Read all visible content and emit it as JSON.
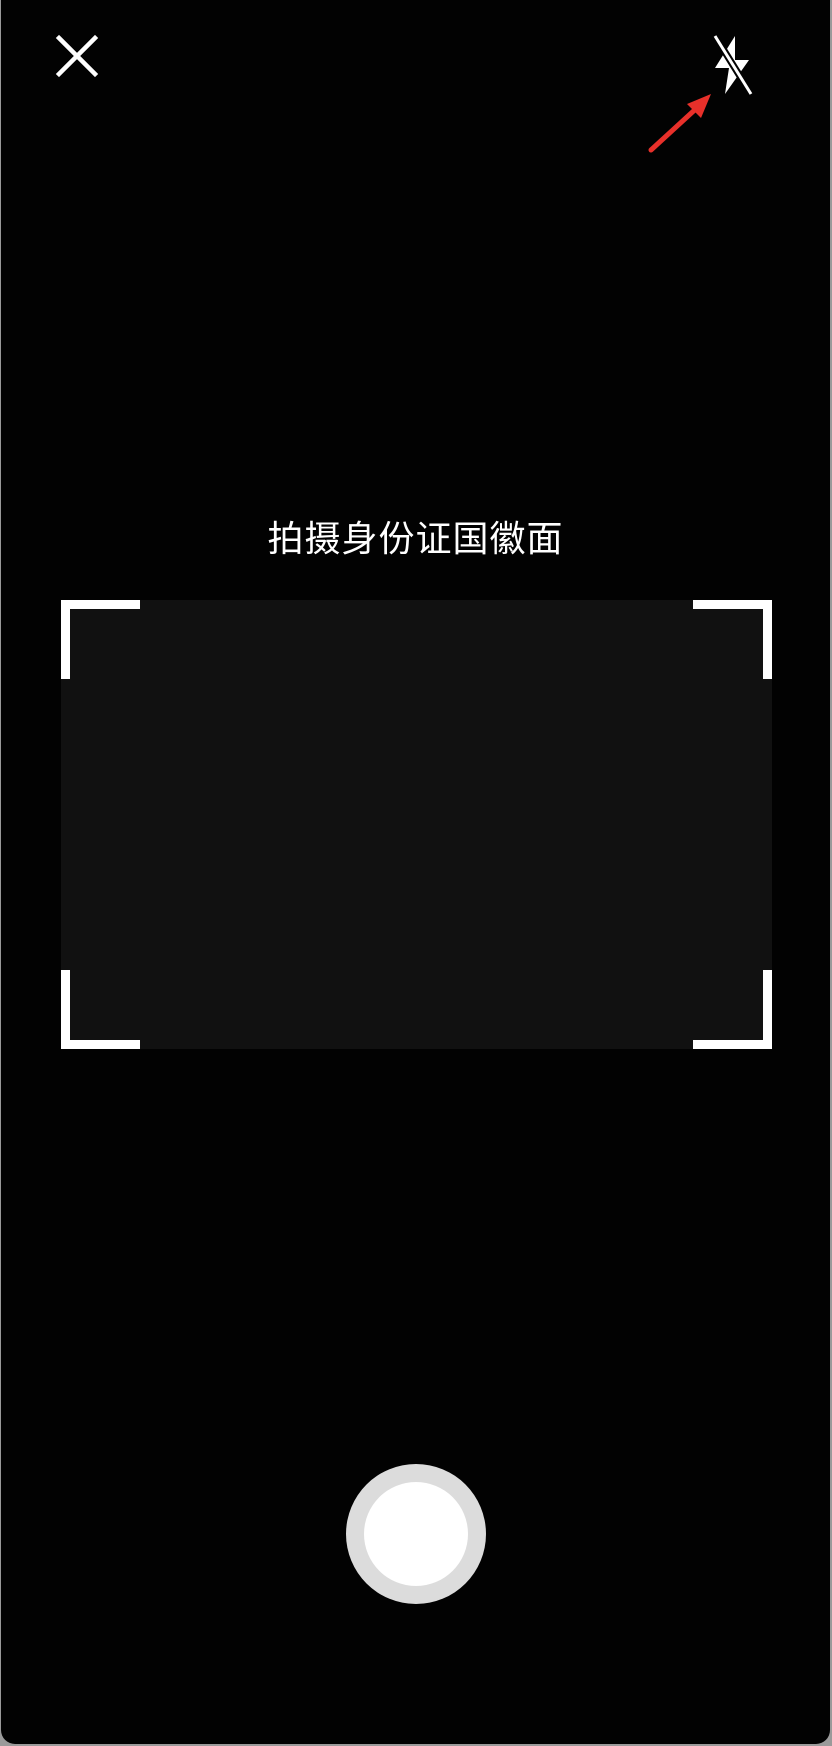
{
  "camera": {
    "prompt": "拍摄身份证国徽面"
  },
  "icons": {
    "close": "close-icon",
    "flash": "flash-off-icon",
    "annotation_arrow": "red-arrow-icon"
  },
  "colors": {
    "background": "#020202",
    "frame_fill": "#111111",
    "corner": "#ffffff",
    "shutter_ring": "#dcdcdc",
    "shutter_core": "#ffffff",
    "annotation": "#e8302a"
  }
}
